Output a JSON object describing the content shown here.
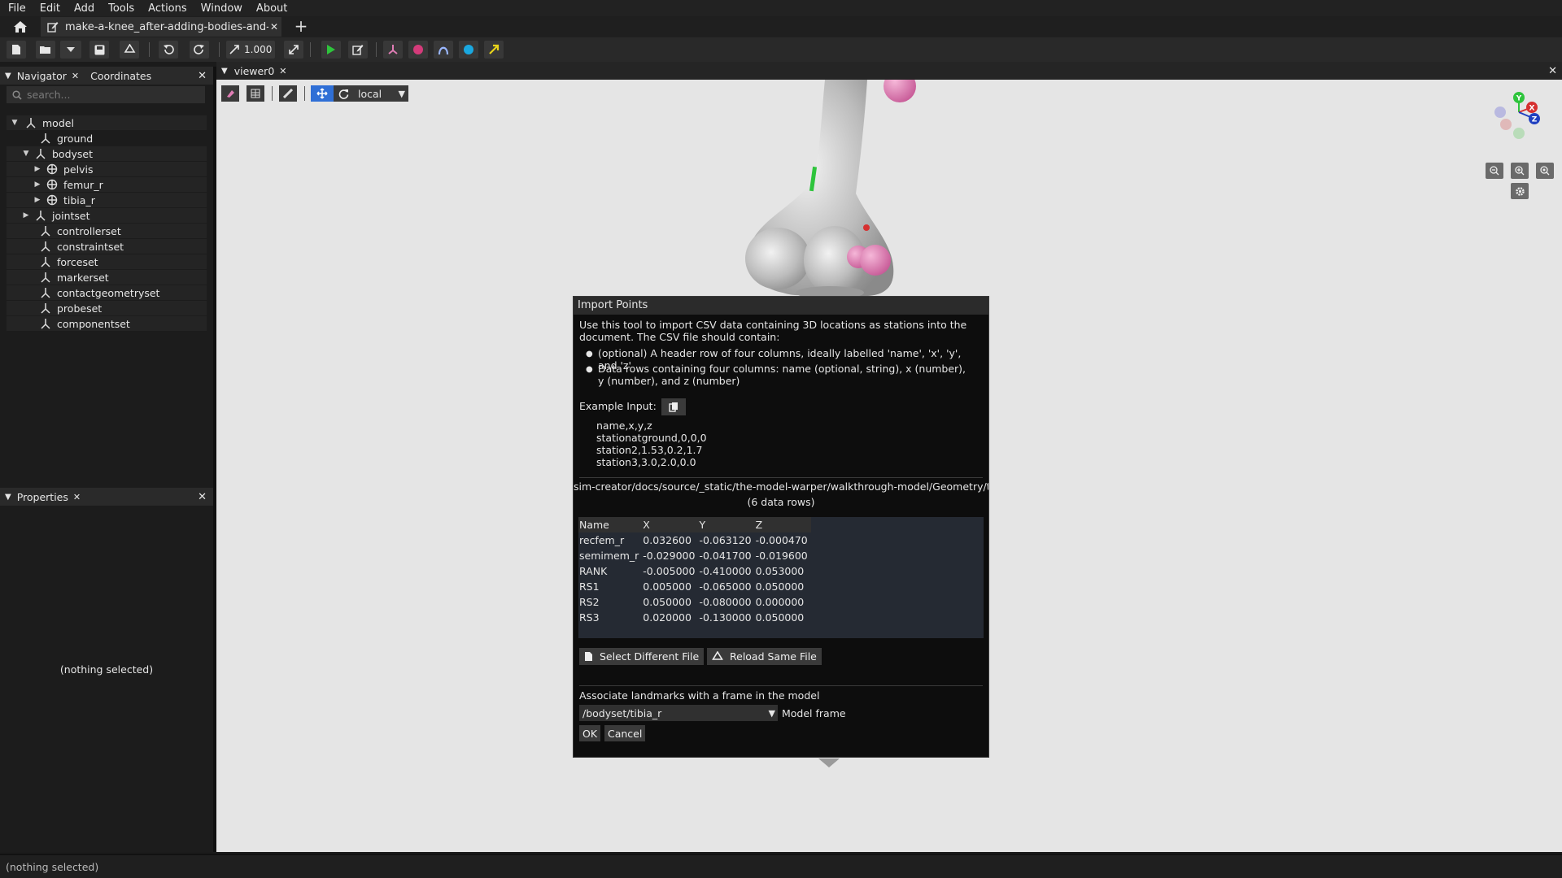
{
  "menu": [
    "File",
    "Edit",
    "Add",
    "Tools",
    "Actions",
    "Window",
    "About"
  ],
  "tab": {
    "label": "make-a-knee_after-adding-bodies-and-joir",
    "close": "✕",
    "new": "+"
  },
  "toolbar": {
    "scale_value": "1.000"
  },
  "navigator": {
    "tab_label": "Navigator",
    "coords_label": "Coordinates",
    "search_placeholder": "search...",
    "tree": [
      "model",
      "ground",
      "bodyset",
      "pelvis",
      "femur_r",
      "tibia_r",
      "jointset",
      "controllerset",
      "constraintset",
      "forceset",
      "markerset",
      "contactgeometryset",
      "probeset",
      "componentset"
    ]
  },
  "properties": {
    "title": "Properties",
    "empty": "(nothing selected)"
  },
  "viewer": {
    "tab_label": "viewer0",
    "frame_mode": "local"
  },
  "status": {
    "text": "(nothing selected)"
  },
  "dialog": {
    "title": "Import Points",
    "intro": "Use this tool to import CSV data containing 3D locations as stations into the document. The CSV file should contain:",
    "bullets": [
      "(optional) A header row of four columns, ideally labelled 'name', 'x', 'y', and 'z'",
      "Data rows containing four columns: name (optional, string), x (number), y (number), and z (number)"
    ],
    "example_label": "Example Input:",
    "example_lines": [
      "name,x,y,z",
      "stationatground,0,0,0",
      "station2,1.53,0.2,1.7",
      "station3,3.0,2.0,0.0"
    ],
    "file_path": "sim-creator/docs/source/_static/the-model-warper/walkthrough-model/Geometry/tib",
    "row_count": "(6 data rows)",
    "columns": [
      "Name",
      "X",
      "Y",
      "Z"
    ],
    "rows": [
      [
        "recfem_r",
        "0.032600",
        "-0.063120",
        "-0.000470"
      ],
      [
        "semimem_r",
        "-0.029000",
        "-0.041700",
        "-0.019600"
      ],
      [
        "RANK",
        "-0.005000",
        "-0.410000",
        "0.053000"
      ],
      [
        "RS1",
        "0.005000",
        "-0.065000",
        "0.050000"
      ],
      [
        "RS2",
        "0.050000",
        "-0.080000",
        "0.000000"
      ],
      [
        "RS3",
        "0.020000",
        "-0.130000",
        "0.050000"
      ]
    ],
    "select_file_label": "Select Different File",
    "reload_label": "Reload Same File",
    "associate_label": "Associate landmarks with a frame in the model",
    "frame_value": "/bodyset/tibia_r",
    "frame_label": "Model frame",
    "ok_label": "OK",
    "cancel_label": "Cancel"
  },
  "colors": {
    "accent_blue": "#2f6fd6",
    "play_green": "#2ec43c",
    "marker_pink": "#e07db5",
    "viewport_bg": "#e5e5e5"
  },
  "axes_gizmo": {
    "y": "Y",
    "x": "X",
    "z": "Z"
  }
}
